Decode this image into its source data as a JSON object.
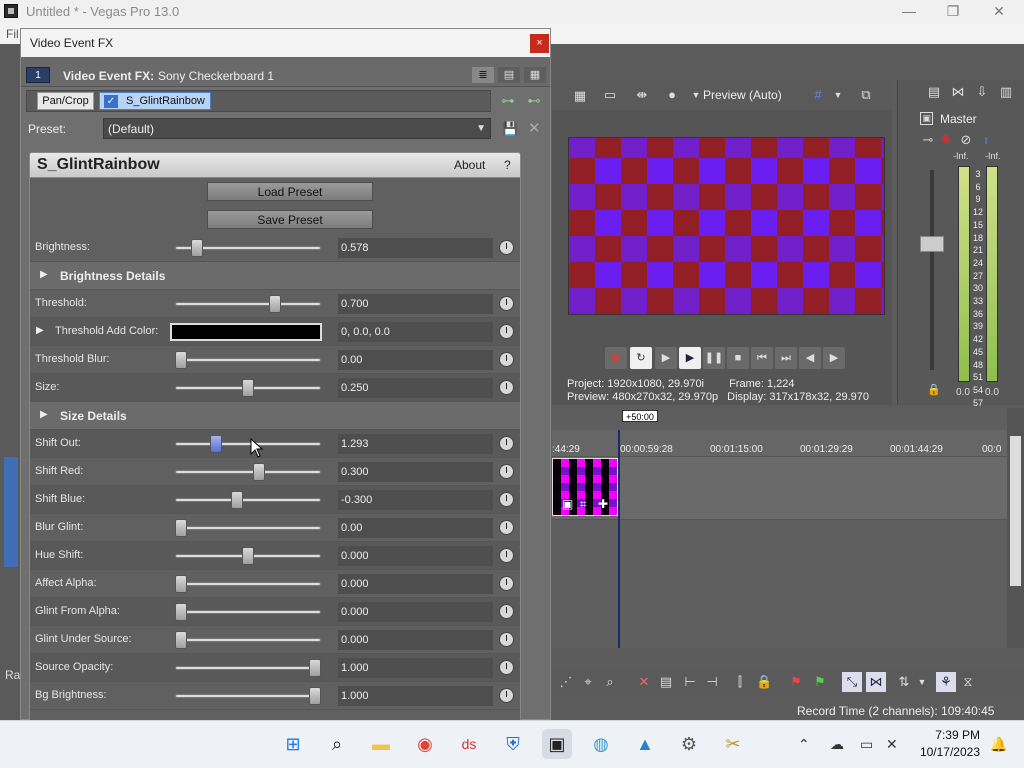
{
  "app": {
    "title": "Untitled * - Vegas Pro 13.0",
    "menu_first": "Fil",
    "window_controls": [
      "—",
      "❐",
      "✕"
    ]
  },
  "preview": {
    "quality": "Preview (Auto)",
    "project_label": "Project:",
    "project_value": "1920x1080, 29.970i",
    "frame_label": "Frame:",
    "frame_value": "1,224",
    "preview_label": "Preview:",
    "preview_value": "480x270x32, 29.970p",
    "display_label": "Display:",
    "display_value": "317x178x32, 29.970"
  },
  "master": {
    "label": "Master",
    "inf_left": "-Inf.",
    "inf_right": "-Inf.",
    "scale": [
      "3",
      "6",
      "9",
      "12",
      "15",
      "18",
      "21",
      "24",
      "27",
      "30",
      "33",
      "36",
      "39",
      "42",
      "45",
      "48",
      "51",
      "54",
      "57"
    ],
    "zero_left": "0.0",
    "zero_right": "0.0"
  },
  "timeline": {
    "timecode_flag": "+50:00",
    "ruler": [
      ":44:29",
      "00:00:59:28",
      "00:01:15:00",
      "00:01:29:29",
      "00:01:44:29",
      "00:0"
    ],
    "status": "Record Time (2 channels): 109:40:45"
  },
  "left_panel": {
    "label": "Ra"
  },
  "dialog": {
    "title": "Video Event FX",
    "close": "×",
    "badge": "1",
    "header_label": "Video Event FX:",
    "header_value": "Sony Checkerboard 1",
    "chain": [
      "Pan/Crop",
      "S_GlintRainbow"
    ],
    "preset_label": "Preset:",
    "preset_value": "(Default)",
    "plugin_name": "S_GlintRainbow",
    "about": "About",
    "help": "?",
    "load_preset": "Load Preset",
    "save_preset": "Save Preset",
    "params": [
      {
        "label": "Brightness:",
        "value": "0.578",
        "pos": 0.12
      },
      {
        "section": "Brightness Details"
      },
      {
        "label": "Threshold:",
        "value": "0.700",
        "pos": 0.7
      },
      {
        "label": "Threshold Add Color:",
        "value": "0, 0.0, 0.0",
        "color": "#000000"
      },
      {
        "label": "Threshold Blur:",
        "value": "0.00",
        "pos": 0.0
      },
      {
        "label": "Size:",
        "value": "0.250",
        "pos": 0.5
      },
      {
        "section": "Size Details"
      },
      {
        "label": "Shift Out:",
        "value": "1.293",
        "pos": 0.26
      },
      {
        "label": "Shift Red:",
        "value": "0.300",
        "pos": 0.58
      },
      {
        "label": "Shift Blue:",
        "value": "-0.300",
        "pos": 0.42
      },
      {
        "label": "Blur Glint:",
        "value": "0.00",
        "pos": 0.0
      },
      {
        "label": "Hue Shift:",
        "value": "0.000",
        "pos": 0.5
      },
      {
        "label": "Affect Alpha:",
        "value": "0.000",
        "pos": 0.0
      },
      {
        "label": "Glint From Alpha:",
        "value": "0.000",
        "pos": 0.0
      },
      {
        "label": "Glint Under Source:",
        "value": "0.000",
        "pos": 0.0
      },
      {
        "label": "Source Opacity:",
        "value": "1.000",
        "pos": 1.0
      },
      {
        "label": "Bg Brightness:",
        "value": "1.000",
        "pos": 1.0
      }
    ]
  },
  "taskbar": {
    "time": "7:39 PM",
    "date": "10/17/2023"
  },
  "colors": {
    "accent": "#3a71c8",
    "close_red": "#c42b1c",
    "checker_magenta": "#ff00ff",
    "checker_blue": "#5a1ff0"
  }
}
